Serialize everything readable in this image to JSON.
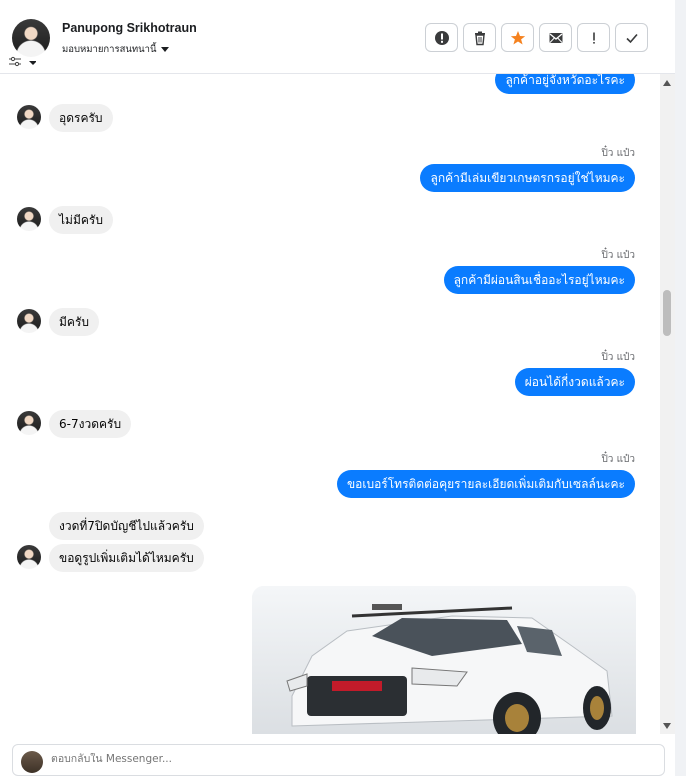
{
  "header": {
    "contact_name": "Panupong Srikhotraun",
    "assign_label": "มอบหมายการสนทนานี้",
    "actions": [
      {
        "name": "alert-circle-icon"
      },
      {
        "name": "trash-icon"
      },
      {
        "name": "star-icon"
      },
      {
        "name": "mail-icon"
      },
      {
        "name": "exclamation-icon"
      },
      {
        "name": "check-icon"
      }
    ],
    "star_color": "#f5821f"
  },
  "messages": [
    {
      "dir": "out",
      "text": "ลูกค้าอยู่จังหวัดอะไรคะ"
    },
    {
      "dir": "in",
      "text": "อุดรครับ"
    },
    {
      "dir": "out",
      "sender": "ปิ๋ว แป๋ว",
      "text": "ลูกค้ามีเล่มเขียวเกษตรกรอยู่ใช่ไหมคะ"
    },
    {
      "dir": "in",
      "text": "ไม่มีครับ"
    },
    {
      "dir": "out",
      "sender": "ปิ๋ว แป๋ว",
      "text": "ลูกค้ามีผ่อนสินเชื่ออะไรอยู่ไหมคะ"
    },
    {
      "dir": "in",
      "text": "มีครับ"
    },
    {
      "dir": "out",
      "sender": "ปิ๋ว แป๋ว",
      "text": "ผ่อนได้กี่งวดแล้วคะ"
    },
    {
      "dir": "in",
      "text": "6-7งวดครับ"
    },
    {
      "dir": "out",
      "sender": "ปิ๋ว แป๋ว",
      "text": "ขอเบอร์โทรติดต่อคุยรายละเอียดเพิ่มเติมกับเซลล์นะคะ"
    },
    {
      "dir": "in",
      "text": "งวดที่7ปิดบัญชีไปแล้วครับ"
    },
    {
      "dir": "in",
      "text": "ขอดูรูปเพิ่มเติมได้ไหมครับ"
    }
  ],
  "composer": {
    "placeholder": "ตอบกลับใน Messenger..."
  },
  "colors": {
    "outgoing_bubble": "#0a7cff",
    "incoming_bubble": "#f0f0f0"
  }
}
